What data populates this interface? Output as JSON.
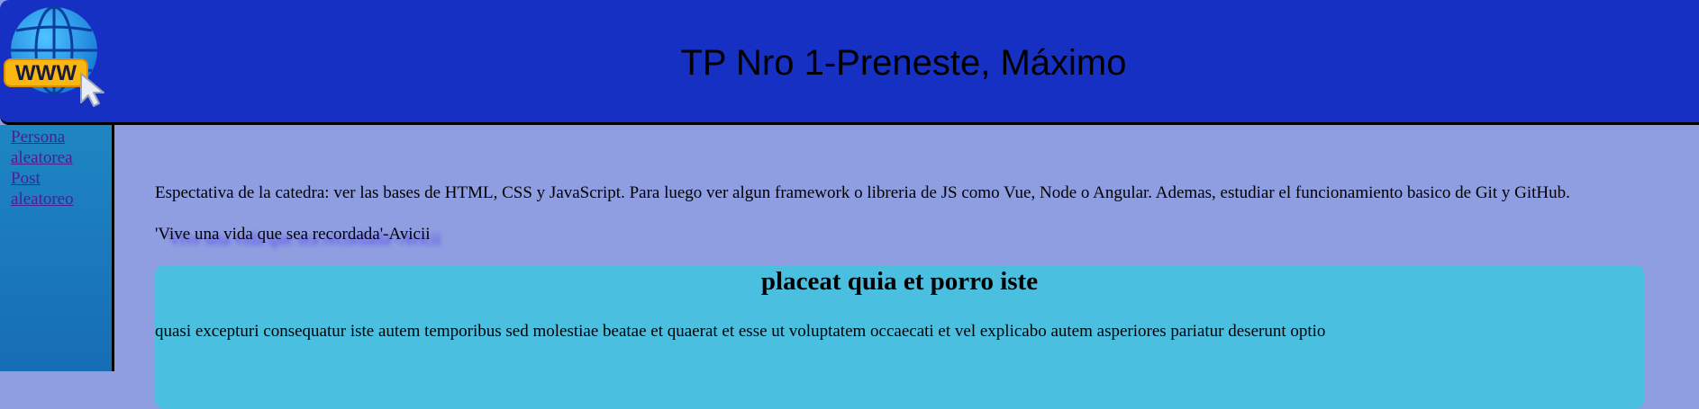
{
  "header": {
    "logo": "www-globe-cursor-icon",
    "logo_text": "WWW",
    "title": "TP Nro 1-Preneste, Máximo"
  },
  "sidebar": {
    "items": [
      {
        "label": "Persona aleatorea"
      },
      {
        "label": "Post aleatoreo"
      }
    ]
  },
  "main": {
    "intro": "Espectativa de la catedra: ver las bases de HTML, CSS y JavaScript. Para luego ver algun framework o libreria de JS como Vue, Node o Angular. Ademas, estudiar el funcionamiento basico de Git y GitHub.",
    "quote": "'Vive una vida que sea recordada'-Avicii",
    "post": {
      "title": "placeat quia et porro iste",
      "body": "quasi excepturi consequatur iste autem temporibus sed molestiae beatae et quaerat et esse ut voluptatem occaecati et vel explicabo autem asperiores pariatur deserunt optio"
    }
  },
  "colors": {
    "header_bg": "#1730c4",
    "page_bg": "#8f9ee0",
    "sidebar_bg": "#1e86c3",
    "card_bg": "#4bbfe0",
    "link": "#4a1f8f",
    "quote_shadow": "#5a3cf0"
  }
}
